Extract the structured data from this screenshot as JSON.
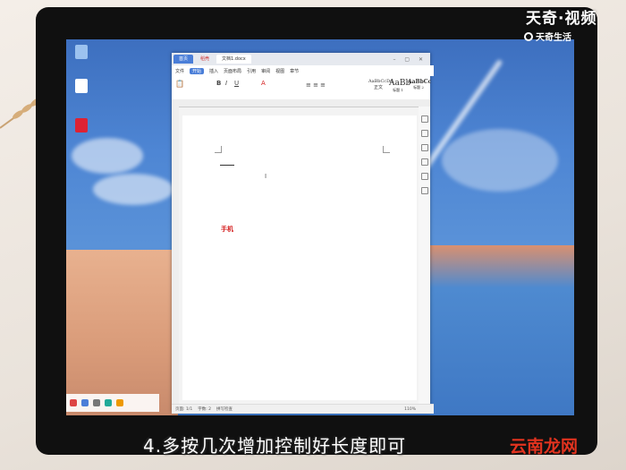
{
  "brand": {
    "top_logo": "天奇·视频",
    "sub_logo": "天奇生活",
    "watermark": "云南龙网"
  },
  "caption": "4.多按几次增加控制好长度即可",
  "wps": {
    "tabs": [
      "首页",
      "稻壳",
      "文档1.docx"
    ],
    "menus": [
      "文件",
      "开始",
      "插入",
      "页面布局",
      "引用",
      "审阅",
      "视图",
      "章节"
    ],
    "active_menu": "开始",
    "ribbon_styles": [
      "AaBbCcDd",
      "AaBb",
      "AaBbCc"
    ],
    "ribbon_style_labels": [
      "正文",
      "标题 1",
      "标题 2"
    ],
    "document_text": "手机",
    "status_items": [
      "页面: 1/1",
      "字数: 2",
      "拼写检查"
    ],
    "zoom": "110%"
  },
  "colors": {
    "accent": "#4a7ed8",
    "doc_text_red": "#d41c1c",
    "watermark_red": "#e2331f"
  }
}
